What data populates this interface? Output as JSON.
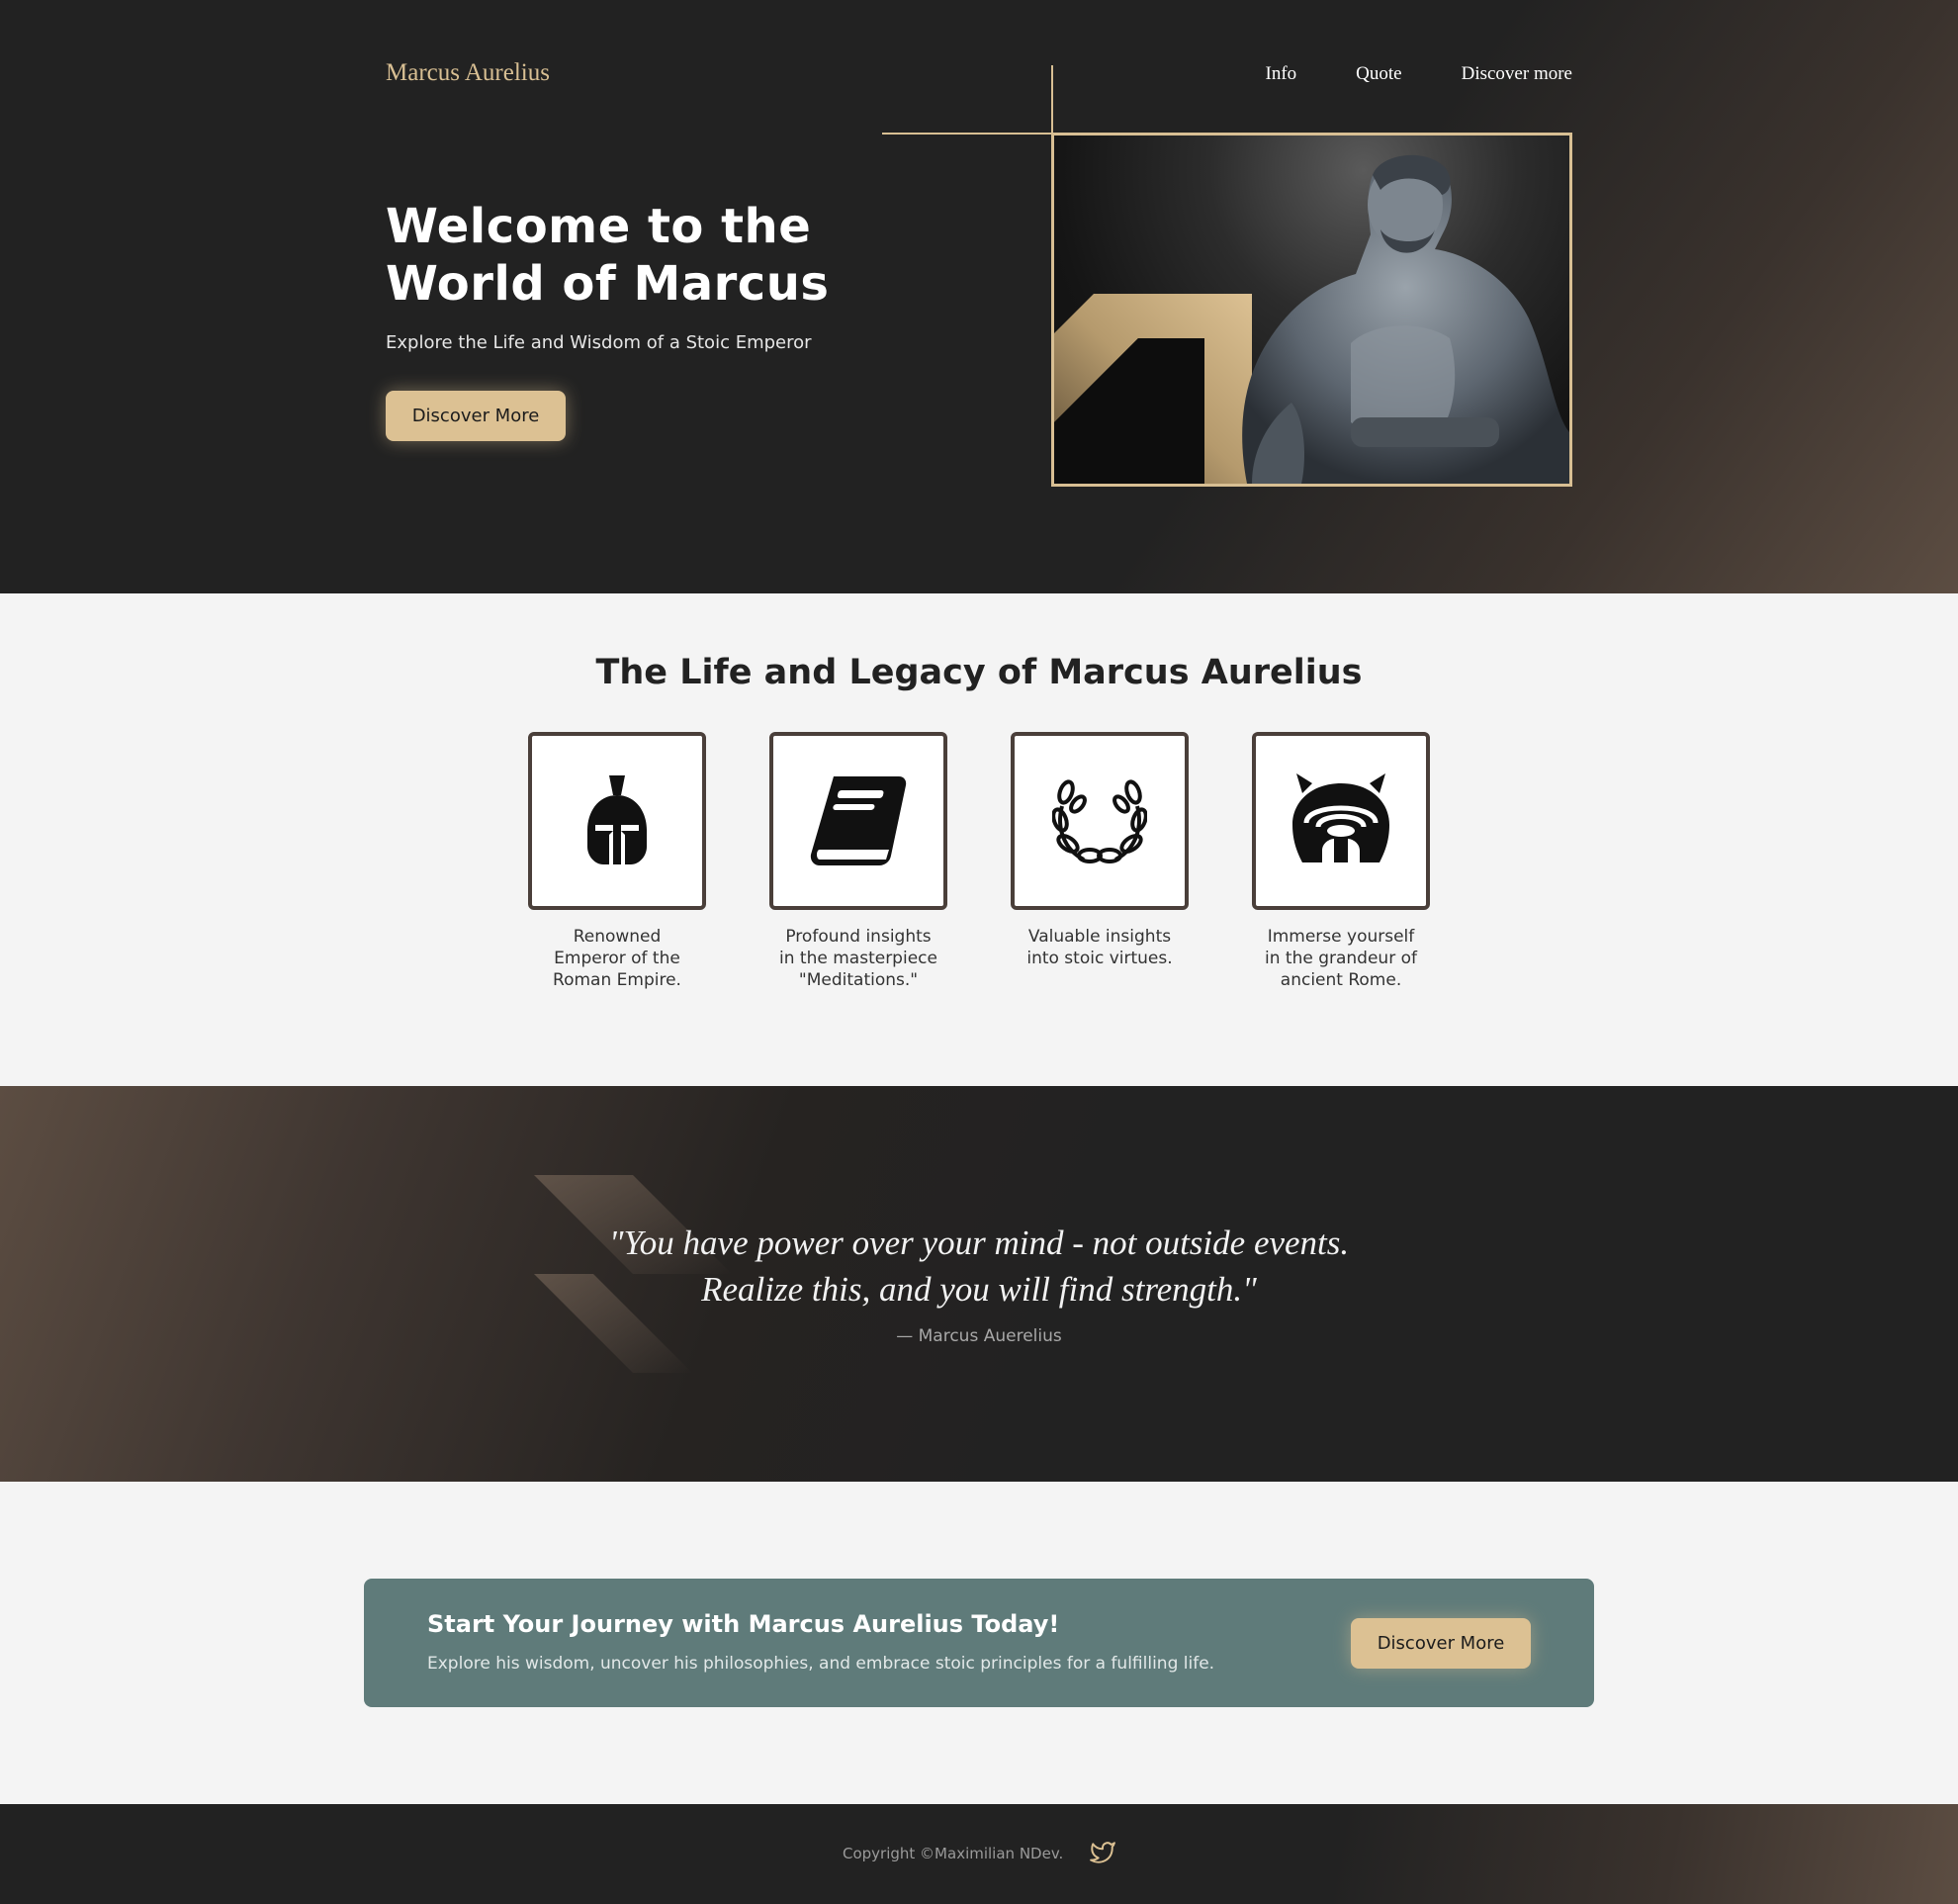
{
  "header": {
    "brand": "Marcus Aurelius",
    "nav": [
      "Info",
      "Quote",
      "Discover more"
    ]
  },
  "hero": {
    "title": "Welcome to the World of Marcus",
    "subtitle": "Explore the Life and Wisdom of a Stoic Emperor",
    "button_label": "Discover More"
  },
  "legacy": {
    "title": "The Life and Legacy of Marcus Aurelius",
    "cards": [
      {
        "icon": "spartan-helmet-icon",
        "text": "Renowned Emperor of the Roman Empire."
      },
      {
        "icon": "book-icon",
        "text": "Profound insights in the masterpiece \"Meditations.\""
      },
      {
        "icon": "laurel-wreath-icon",
        "text": "Valuable insights into stoic virtues."
      },
      {
        "icon": "colosseum-icon",
        "text": "Immerse yourself in the grandeur of ancient Rome."
      }
    ]
  },
  "quote": {
    "line1": "\"You have power over your mind - not outside events.",
    "line2": "Realize this, and you will find strength.\"",
    "author": "— Marcus Auerelius"
  },
  "cta": {
    "title": "Start Your Journey with Marcus Aurelius Today!",
    "subtitle": "Explore his wisdom, uncover his philosophies, and embrace stoic principles for a fulfilling life.",
    "button_label": "Discover More"
  },
  "footer": {
    "copyright": "Copyright ©Maximilian NDev.",
    "social_icon": "twitter-icon"
  },
  "colors": {
    "dark": "#222222",
    "gold": "#dcc193",
    "teal": "#5f7b7a",
    "light": "#f4f4f4"
  }
}
